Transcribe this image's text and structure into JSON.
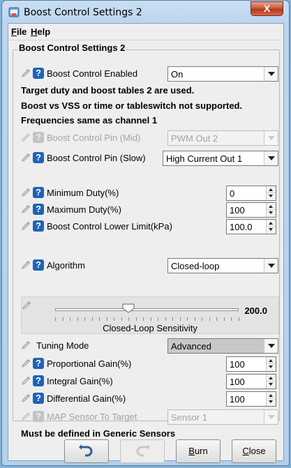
{
  "window": {
    "title": "Boost Control Settings 2",
    "close_glyph": "X"
  },
  "menu": {
    "file_m": "F",
    "file_rest": "ile",
    "help_m": "H",
    "help_rest": "elp"
  },
  "panel": {
    "title": "Boost Control Settings 2"
  },
  "rows": {
    "enabled": {
      "label": "Boost Control Enabled",
      "value": "On"
    },
    "pin_mid": {
      "label": "Boost Control Pin (Mid)",
      "value": "PWM Out 2"
    },
    "pin_slow": {
      "label": "Boost Control Pin (Slow)",
      "value": "High Current Out 1"
    },
    "min_duty": {
      "label": "Minimum Duty(%)",
      "value": "0"
    },
    "max_duty": {
      "label": "Maximum Duty(%)",
      "value": "100"
    },
    "lower_limit": {
      "label": "Boost Control Lower Limit(kPa)",
      "value": "100.0"
    },
    "algorithm": {
      "label": "Algorithm",
      "value": "Closed-loop"
    },
    "tuning_mode": {
      "label": "Tuning Mode",
      "value": "Advanced"
    },
    "prop_gain": {
      "label": "Proportional Gain(%)",
      "value": "100"
    },
    "int_gain": {
      "label": "Integral Gain(%)",
      "value": "100"
    },
    "diff_gain": {
      "label": "Differential Gain(%)",
      "value": "100"
    },
    "map_sensor": {
      "label": "MAP Sensor To Target",
      "value": "Sensor 1"
    }
  },
  "notes": {
    "n1": "Target duty and boost tables 2 are used.",
    "n2": "Boost vs VSS or time or tableswitch not supported.",
    "n3": "Frequencies same as channel 1",
    "footer": "Must be defined in Generic Sensors"
  },
  "slider": {
    "value": "200.0",
    "caption": "Closed-Loop Sensitivity",
    "position_fraction": 0.4
  },
  "buttons": {
    "burn_m": "B",
    "burn_rest": "urn",
    "close_m": "C",
    "close_rest": "lose"
  },
  "colors": {
    "help_icon": "#1e63b8",
    "title_bar": "#bcd6ef",
    "close_button": "#c75b3c"
  }
}
